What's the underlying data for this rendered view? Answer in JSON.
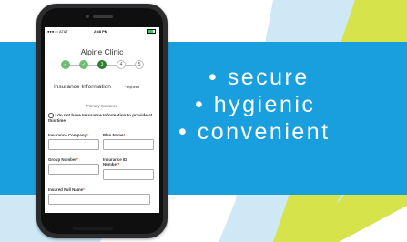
{
  "colors": {
    "band_blue": "#1a9fde",
    "stripe_yellow": "#d6e34a",
    "stripe_lightblue": "#cfe8f5",
    "step_done": "#6fbf73",
    "step_current": "#2e7d32",
    "required_red": "#e53935"
  },
  "phone": {
    "status": {
      "carrier": "●●●○○ AT&T",
      "time": "2:48 PM"
    },
    "clinic_name": "Alpine Clinic",
    "steps": [
      {
        "label": "✓",
        "state": "done"
      },
      {
        "label": "✓",
        "state": "done"
      },
      {
        "label": "3",
        "state": "current"
      },
      {
        "label": "4",
        "state": "todo"
      },
      {
        "label": "5",
        "state": "todo"
      }
    ],
    "section_title": "Insurance Information",
    "required_note_star": "*",
    "required_note_text": "required",
    "primary_label": "Primary Insurance",
    "no_insurance_checkbox_label": "I do not have Insurance Information to provide at this time",
    "fields": {
      "insurance_company": {
        "label": "Insurance Company",
        "star": "*"
      },
      "plan_name": {
        "label": "Plan Name",
        "star": "*"
      },
      "group_number": {
        "label": "Group Number",
        "star": "*"
      },
      "insurance_id": {
        "label": "Insurance ID Number",
        "star": "*"
      },
      "insured_full_name": {
        "label": "Insured Full Name",
        "star": "*"
      }
    }
  },
  "bullets": [
    "• secure",
    "• hygienic",
    "• convenient"
  ]
}
